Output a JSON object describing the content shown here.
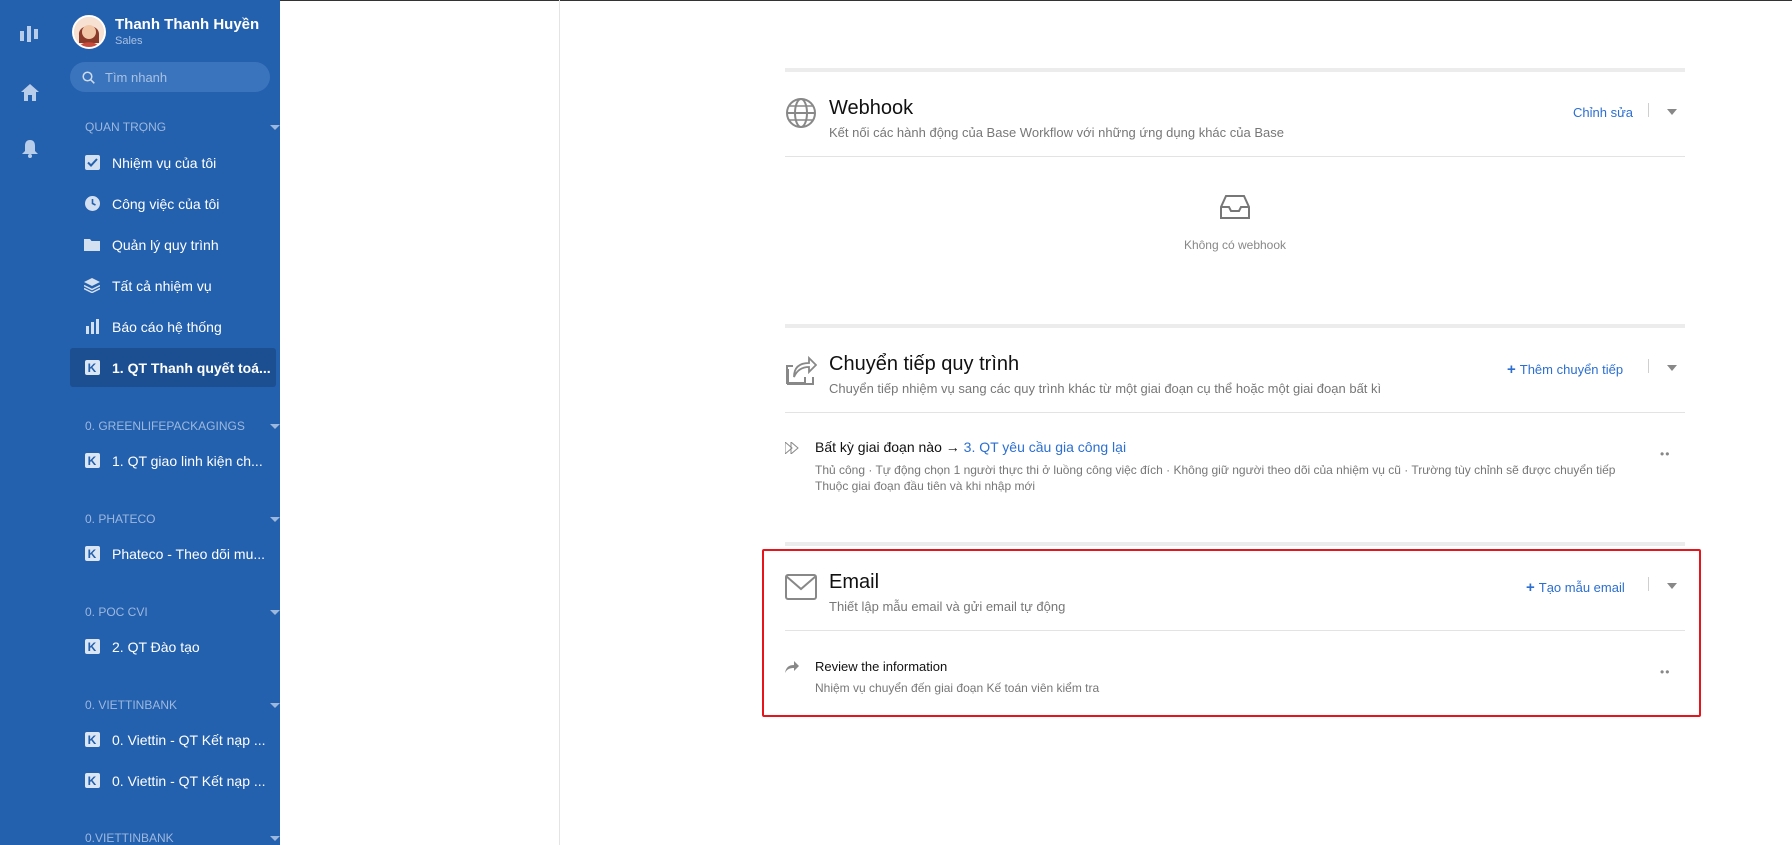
{
  "user": {
    "name": "Thanh Thanh Huyền",
    "role": "Sales"
  },
  "search": {
    "placeholder": "Tìm nhanh"
  },
  "sidebar": {
    "sections": [
      {
        "title": "QUAN TRỌNG"
      },
      {
        "title": "0. GREENLIFEPACKAGINGS"
      },
      {
        "title": "0. PHATECO"
      },
      {
        "title": "0. POC CVI"
      },
      {
        "title": "0. VIETTINBANK"
      },
      {
        "title": "0.VIETTINBANK"
      }
    ],
    "items": [
      {
        "label": "Nhiệm vụ của tôi",
        "icon": "checkbox-icon"
      },
      {
        "label": "Công việc của tôi",
        "icon": "clock-icon"
      },
      {
        "label": "Quản lý quy trình",
        "icon": "folder-icon"
      },
      {
        "label": "Tất cả nhiệm vụ",
        "icon": "layers-icon"
      },
      {
        "label": "Báo cáo hệ thống",
        "icon": "bar-chart-icon"
      },
      {
        "label": "1. QT Thanh quyết toá...",
        "icon": "workflow-icon",
        "active": true
      },
      {
        "label": "1. QT giao linh kiện ch...",
        "icon": "workflow-icon"
      },
      {
        "label": "Phateco - Theo dõi mu...",
        "icon": "workflow-icon"
      },
      {
        "label": "2. QT Đào tạo",
        "icon": "workflow-icon"
      },
      {
        "label": "0. Viettin - QT Kết nạp ...",
        "icon": "workflow-icon"
      },
      {
        "label": "0. Viettin - QT Kết nạp ...",
        "icon": "workflow-icon"
      }
    ]
  },
  "webhook": {
    "title": "Webhook",
    "description": "Kết nối các hành động của Base Workflow với những ứng dụng khác của Base",
    "action": "Chỉnh sửa",
    "empty_text": "Không có webhook"
  },
  "transfer": {
    "title": "Chuyển tiếp quy trình",
    "description": "Chuyển tiếp nhiệm vụ sang các quy trình khác từ một giai đoạn cụ thể hoặc một giai đoạn bất kì",
    "action": "Thêm chuyển tiếp",
    "rule": {
      "source": "Bất kỳ giai đoạn nào",
      "arrow": "→",
      "target": "3. QT yêu cầu gia công lại",
      "detail1": "Thủ công · Tự động chọn 1 người thực thi ở luồng công việc đích · Không giữ người theo dõi của nhiệm vụ cũ · Trường tùy chỉnh sẽ được chuyển tiếp",
      "detail2": "Thuộc giai đoạn đầu tiên và khi nhập mới"
    }
  },
  "email": {
    "title": "Email",
    "description": "Thiết lập mẫu email và gửi email tự động",
    "action": "Tạo mẫu email",
    "template": {
      "title": "Review the information",
      "detail": "Nhiệm vụ chuyển đến giai đoạn Kế toán viên kiểm tra"
    }
  },
  "colors": {
    "sidebar": "#2360ad",
    "accent": "#2c6fd1",
    "highlight": "#e8141b"
  }
}
